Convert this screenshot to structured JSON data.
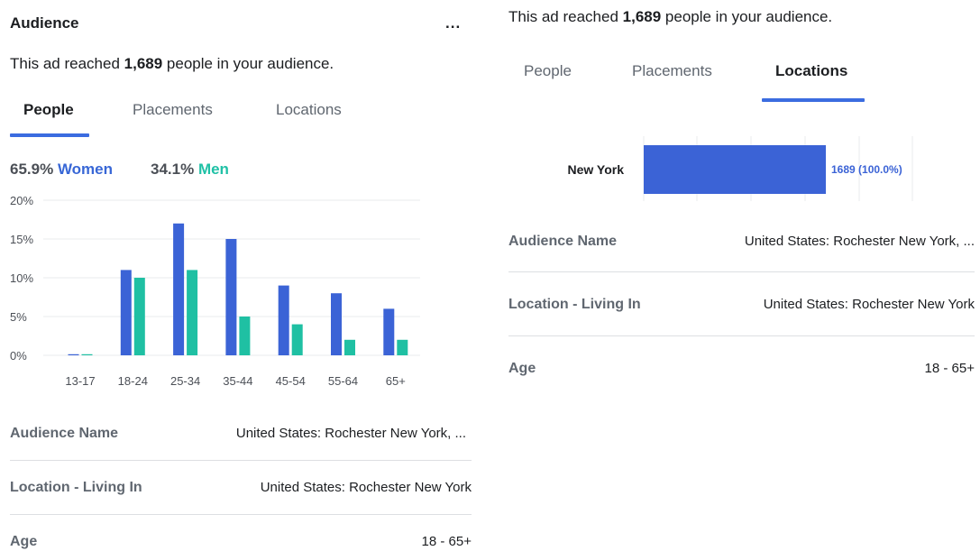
{
  "left": {
    "title": "Audience",
    "more_label": "...",
    "reach": {
      "prefix": "This ad reached ",
      "count": "1,689",
      "suffix": " people in your audience."
    },
    "tabs": [
      {
        "label": "People",
        "active": true
      },
      {
        "label": "Placements",
        "active": false
      },
      {
        "label": "Locations",
        "active": false
      }
    ],
    "gender": {
      "women_pct": "65.9%",
      "women_label": "Women",
      "men_pct": "34.1%",
      "men_label": "Men"
    },
    "rows": [
      {
        "label": "Audience Name",
        "value": "United States: Rochester New York, ..."
      },
      {
        "label": "Location - Living In",
        "value": "United States: Rochester New York"
      },
      {
        "label": "Age",
        "value": "18 - 65+"
      }
    ]
  },
  "right": {
    "reach": {
      "prefix": "This ad reached ",
      "count": "1,689",
      "suffix": " people in your audience."
    },
    "tabs": [
      {
        "label": "People",
        "active": false
      },
      {
        "label": "Placements",
        "active": false
      },
      {
        "label": "Locations",
        "active": true
      }
    ],
    "rows": [
      {
        "label": "Audience Name",
        "value": "United States: Rochester New York, ..."
      },
      {
        "label": "Location - Living In",
        "value": "United States: Rochester New York"
      },
      {
        "label": "Age",
        "value": "18 - 65+"
      }
    ]
  },
  "colors": {
    "women": "#3b63d6",
    "men": "#1fc0a3",
    "accent": "#3b6ce0"
  },
  "chart_data": [
    {
      "type": "bar",
      "categories": [
        "13-17",
        "18-24",
        "25-34",
        "35-44",
        "45-54",
        "55-64",
        "65+"
      ],
      "series": [
        {
          "name": "Women",
          "values": [
            0.1,
            11,
            17,
            15,
            9,
            8,
            6
          ]
        },
        {
          "name": "Men",
          "values": [
            0.1,
            10,
            11,
            5,
            4,
            2,
            2
          ]
        }
      ],
      "yticks": [
        "0%",
        "5%",
        "10%",
        "15%",
        "20%"
      ],
      "ylim": [
        0,
        20
      ],
      "grid": true
    },
    {
      "type": "bar",
      "orientation": "horizontal",
      "categories": [
        "New York"
      ],
      "values": [
        1689
      ],
      "value_labels": [
        "1689 (100.0%)"
      ],
      "grid": true
    }
  ]
}
